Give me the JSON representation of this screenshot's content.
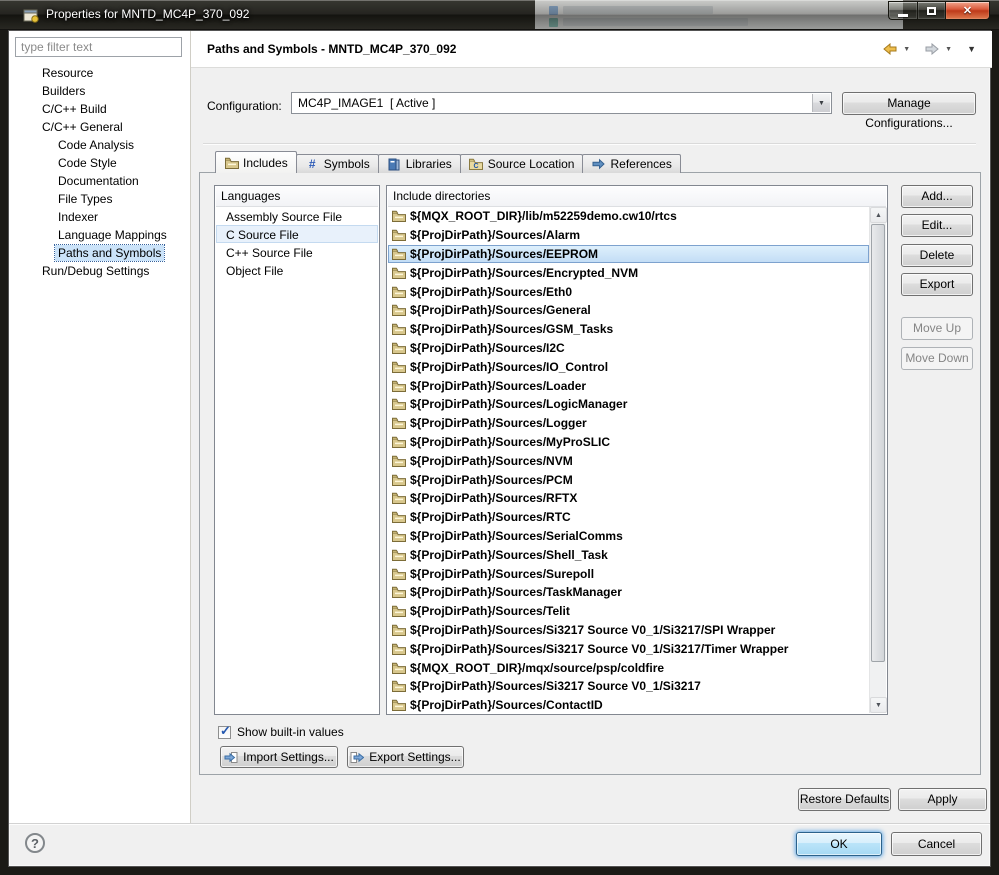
{
  "icons": {
    "close": "✕",
    "help": "?",
    "dropdown": "▼",
    "check": "✓",
    "scroll_up": "▲",
    "scroll_down": "▼"
  },
  "window": {
    "title": "Properties for MNTD_MC4P_370_092"
  },
  "sidebar": {
    "filter_placeholder": "type filter text",
    "tree": [
      {
        "label": "Resource",
        "level": 1
      },
      {
        "label": "Builders",
        "level": 1
      },
      {
        "label": "C/C++ Build",
        "level": 1
      },
      {
        "label": "C/C++ General",
        "level": 1
      },
      {
        "label": "Code Analysis",
        "level": 2
      },
      {
        "label": "Code Style",
        "level": 2
      },
      {
        "label": "Documentation",
        "level": 2
      },
      {
        "label": "File Types",
        "level": 2
      },
      {
        "label": "Indexer",
        "level": 2
      },
      {
        "label": "Language Mappings",
        "level": 2
      },
      {
        "label": "Paths and Symbols",
        "level": 2,
        "selected": true
      },
      {
        "label": "Run/Debug Settings",
        "level": 1
      }
    ]
  },
  "header": {
    "title": "Paths and Symbols - MNTD_MC4P_370_092"
  },
  "configuration": {
    "label": "Configuration:",
    "value": "MC4P_IMAGE1  [ Active ]",
    "manage_button": "Manage Configurations..."
  },
  "tabs": [
    {
      "label": "Includes",
      "icon": "include-folder-icon",
      "active": true
    },
    {
      "label": "Symbols",
      "icon": "hash-symbol-icon",
      "active": false
    },
    {
      "label": "Libraries",
      "icon": "library-icon",
      "active": false
    },
    {
      "label": "Source Location",
      "icon": "source-folder-icon",
      "active": false
    },
    {
      "label": "References",
      "icon": "references-icon",
      "active": false
    }
  ],
  "languages": {
    "header": "Languages",
    "selected_index": 1,
    "items": [
      "Assembly Source File",
      "C Source File",
      "C++ Source File",
      "Object File"
    ]
  },
  "includes": {
    "header": "Include directories",
    "selected_index": 2,
    "items": [
      "${MQX_ROOT_DIR}/lib/m52259demo.cw10/rtcs",
      "${ProjDirPath}/Sources/Alarm",
      "${ProjDirPath}/Sources/EEPROM",
      "${ProjDirPath}/Sources/Encrypted_NVM",
      "${ProjDirPath}/Sources/Eth0",
      "${ProjDirPath}/Sources/General",
      "${ProjDirPath}/Sources/GSM_Tasks",
      "${ProjDirPath}/Sources/I2C",
      "${ProjDirPath}/Sources/IO_Control",
      "${ProjDirPath}/Sources/Loader",
      "${ProjDirPath}/Sources/LogicManager",
      "${ProjDirPath}/Sources/Logger",
      "${ProjDirPath}/Sources/MyProSLIC",
      "${ProjDirPath}/Sources/NVM",
      "${ProjDirPath}/Sources/PCM",
      "${ProjDirPath}/Sources/RFTX",
      "${ProjDirPath}/Sources/RTC",
      "${ProjDirPath}/Sources/SerialComms",
      "${ProjDirPath}/Sources/Shell_Task",
      "${ProjDirPath}/Sources/Surepoll",
      "${ProjDirPath}/Sources/TaskManager",
      "${ProjDirPath}/Sources/Telit",
      "${ProjDirPath}/Sources/Si3217 Source V0_1/Si3217/SPI Wrapper",
      "${ProjDirPath}/Sources/Si3217 Source V0_1/Si3217/Timer Wrapper",
      "${MQX_ROOT_DIR}/mqx/source/psp/coldfire",
      "${ProjDirPath}/Sources/Si3217 Source V0_1/Si3217",
      "${ProjDirPath}/Sources/ContactID"
    ]
  },
  "side_buttons": [
    {
      "label": "Add...",
      "enabled": true
    },
    {
      "label": "Edit...",
      "enabled": true
    },
    {
      "label": "Delete",
      "enabled": true
    },
    {
      "label": "Export",
      "enabled": true
    },
    {
      "label": "Move Up",
      "enabled": false
    },
    {
      "label": "Move Down",
      "enabled": false
    }
  ],
  "footer": {
    "show_builtin": "Show built-in values",
    "show_builtin_checked": true,
    "import_button": "Import Settings...",
    "export_button": "Export Settings...",
    "restore_defaults": "Restore Defaults",
    "apply": "Apply",
    "ok": "OK",
    "cancel": "Cancel"
  }
}
